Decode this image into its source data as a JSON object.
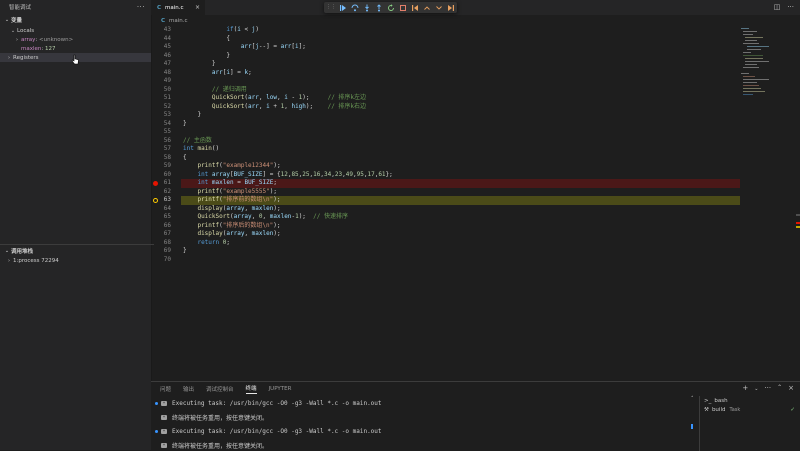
{
  "sidebar": {
    "title": "智能调试",
    "more_icon": "more-icon",
    "variables_title": "变量",
    "locals_label": "Locals",
    "var_array_name": "array",
    "var_array_value": "<unknown>",
    "var_maxlen_name": "maxlen",
    "var_maxlen_value": "127",
    "registers_label": "Registers",
    "callstack_title": "调用堆栈",
    "callstack_item": "1:process 72294"
  },
  "tabs": [
    {
      "label": "main.c",
      "icon": "c-file-icon",
      "close": "×"
    }
  ],
  "breadcrumb": {
    "file": "main.c"
  },
  "debug_toolbar": {
    "icons": [
      "drag-grip-icon",
      "continue-icon",
      "step-over-icon",
      "step-into-icon",
      "step-out-icon",
      "restart-icon",
      "stop-icon",
      "reverse-first-icon",
      "reverse-continue-icon",
      "step-up-icon",
      "step-down-icon",
      "last-icon"
    ],
    "colors": {
      "green": "#89d185",
      "blue": "#75beff",
      "orange": "#e8a060",
      "red": "#f48771"
    }
  },
  "editor": {
    "lines": [
      {
        "n": "43",
        "html": "            if(i < j)"
      },
      {
        "n": "44",
        "html": "            {"
      },
      {
        "n": "45",
        "html": "                arr[j--] = arr[i];"
      },
      {
        "n": "46",
        "html": "            }"
      },
      {
        "n": "47",
        "html": "        }"
      },
      {
        "n": "48",
        "html": "        arr[i] = k;"
      },
      {
        "n": "49",
        "html": ""
      },
      {
        "n": "50",
        "html": "        // 递归调用"
      },
      {
        "n": "51",
        "html": "        QuickSort(arr, low, i - 1);     // 排序k左边"
      },
      {
        "n": "52",
        "html": "        QuickSort(arr, i + 1, high);    // 排序k右边"
      },
      {
        "n": "53",
        "html": "    }"
      },
      {
        "n": "54",
        "html": "}"
      },
      {
        "n": "55",
        "html": ""
      },
      {
        "n": "56",
        "html": "// 主函数"
      },
      {
        "n": "57",
        "html": "int main()"
      },
      {
        "n": "58",
        "html": "{"
      },
      {
        "n": "59",
        "html": "    printf(\"example12344\");"
      },
      {
        "n": "60",
        "html": "    int array[BUF_SIZE] = {12,85,25,16,34,23,49,95,17,61};"
      },
      {
        "n": "61",
        "html": "    int maxlen = BUF_SIZE;"
      },
      {
        "n": "62",
        "html": "    printf(\"example5555\");"
      },
      {
        "n": "63",
        "html": "    printf(\"排序前的数组\\n\");"
      },
      {
        "n": "64",
        "html": "    display(array, maxlen);"
      },
      {
        "n": "65",
        "html": "    QuickSort(array, 0, maxlen-1);  // 快速排序"
      },
      {
        "n": "66",
        "html": "    printf(\"排序后的数组\\n\");"
      },
      {
        "n": "67",
        "html": "    display(array, maxlen);"
      },
      {
        "n": "68",
        "html": "    return 0;"
      },
      {
        "n": "69",
        "html": "}"
      },
      {
        "n": "70",
        "html": ""
      }
    ],
    "breakpoint_line": "61",
    "paused_line": "63"
  },
  "panel": {
    "tabs": [
      "问题",
      "输出",
      "调试控制台",
      "终端",
      "JUPYTER"
    ],
    "active_tab": "终端",
    "terminal_lines": [
      {
        "text": "Executing task: /usr/bin/gcc -O0 -g3 -Wall *.c -o main.out",
        "dot": true
      },
      {
        "text": "终端将被任务重用，按任意键关闭。",
        "dot": false
      },
      {
        "text": "Executing task: /usr/bin/gcc -O0 -g3 -Wall *.c -o main.out",
        "dot": true
      },
      {
        "text": "终端将被任务重用，按任意键关闭。",
        "dot": false
      }
    ],
    "terminal_list": [
      {
        "name": "bash",
        "task": ""
      },
      {
        "name": "build",
        "task": "Task"
      }
    ]
  }
}
